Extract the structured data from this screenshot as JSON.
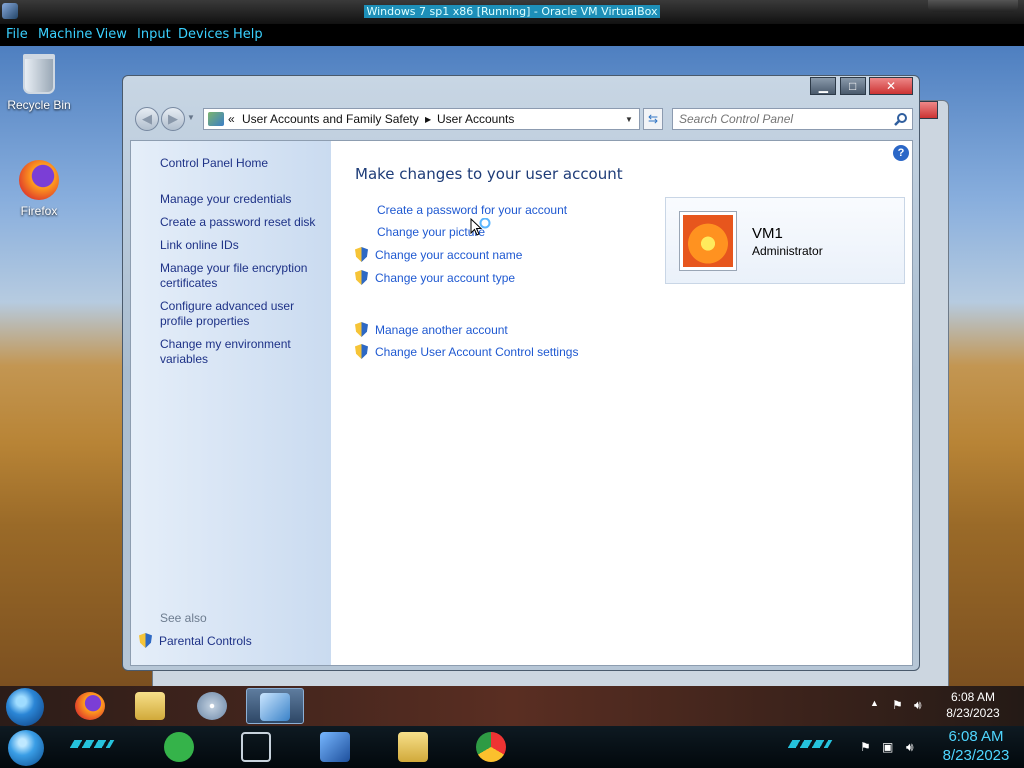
{
  "host": {
    "title": "Windows 7 sp1 x86 [Running] - Oracle VM VirtualBox",
    "menu": [
      "File",
      "Machine",
      "View",
      "Input",
      "Devices",
      "Help"
    ]
  },
  "desktop": {
    "icons": [
      {
        "label": "Recycle Bin",
        "icon": "recycle-bin-icon"
      },
      {
        "label": "Firefox",
        "icon": "firefox-icon"
      }
    ]
  },
  "window": {
    "breadcrumb": [
      "User Accounts and Family Safety",
      "User Accounts"
    ],
    "breadcrumb_lead": "«",
    "search": {
      "placeholder": "Search Control Panel"
    }
  },
  "left_pane": {
    "home": "Control Panel Home",
    "links": [
      "Manage your credentials",
      "Create a password reset disk",
      "Link online IDs",
      "Manage your file encryption certificates",
      "Configure advanced user profile properties",
      "Change my environment variables"
    ],
    "see_also_label": "See also",
    "see_also": [
      "Parental Controls"
    ]
  },
  "main": {
    "heading": "Make changes to your user account",
    "tasks": [
      {
        "label": "Create a password for your account",
        "shield": false
      },
      {
        "label": "Change your picture",
        "shield": false
      },
      {
        "label": "Change your account name",
        "shield": true
      },
      {
        "label": "Change your account type",
        "shield": true
      }
    ],
    "other_tasks": [
      {
        "label": "Manage another account",
        "shield": true
      },
      {
        "label": "Change User Account Control settings",
        "shield": true
      }
    ],
    "account": {
      "name": "VM1",
      "role": "Administrator"
    }
  },
  "guest_taskbar": {
    "time": "6:08 AM",
    "date": "8/23/2023"
  },
  "host_taskbar": {
    "time": "6:08 AM",
    "date": "8/23/2023"
  },
  "colors": {
    "link": "#1f59d1",
    "heading": "#1e3c78",
    "host_menu": "#3ad1ff",
    "host_clock": "#4fd6ff"
  }
}
